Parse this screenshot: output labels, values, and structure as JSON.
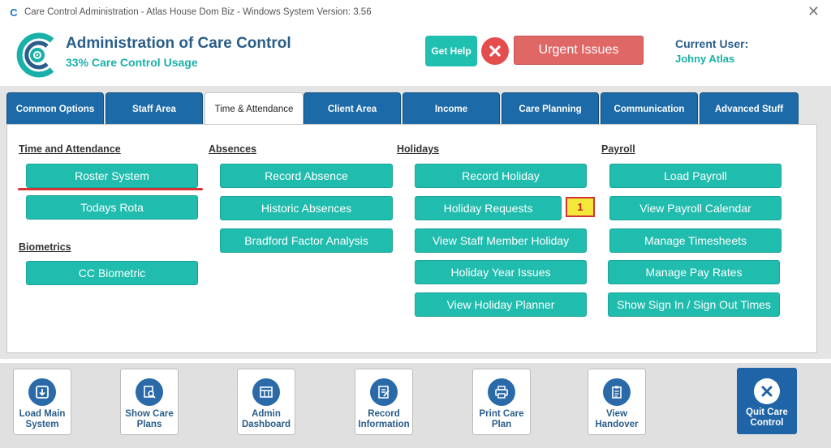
{
  "window": {
    "title": "Care Control Administration - Atlas House Dom Biz - Windows System Version: 3.56",
    "close_glyph": "✕"
  },
  "header": {
    "title": "Administration of Care Control",
    "subtitle": "33% Care Control Usage",
    "get_help": "Get Help",
    "urgent_issues": "Urgent Issues",
    "current_user_label": "Current User:",
    "current_user_name": "Johny Atlas"
  },
  "tabs": [
    {
      "label": "Common Options"
    },
    {
      "label": "Staff Area"
    },
    {
      "label": "Time & Attendance"
    },
    {
      "label": "Client Area"
    },
    {
      "label": "Income"
    },
    {
      "label": "Care Planning"
    },
    {
      "label": "Communication"
    },
    {
      "label": "Advanced Stuff"
    }
  ],
  "sections": {
    "time_attendance": {
      "title": "Time and Attendance",
      "buttons": [
        "Roster System",
        "Todays Rota"
      ]
    },
    "biometrics": {
      "title": "Biometrics",
      "buttons": [
        "CC Biometric"
      ]
    },
    "absences": {
      "title": "Absences",
      "buttons": [
        "Record Absence",
        "Historic Absences",
        "Bradford Factor Analysis"
      ]
    },
    "holidays": {
      "title": "Holidays",
      "buttons": [
        "Record Holiday",
        "Holiday Requests",
        "View Staff Member Holiday",
        "Holiday Year Issues",
        "View Holiday Planner"
      ],
      "requests_badge": "1"
    },
    "payroll": {
      "title": "Payroll",
      "buttons": [
        "Load Payroll",
        "View Payroll Calendar",
        "Manage Timesheets",
        "Manage Pay Rates",
        "Show Sign In / Sign Out Times"
      ]
    }
  },
  "quick_buttons": [
    {
      "label1": "Load Main",
      "label2": "System",
      "icon": "download-icon"
    },
    {
      "label1": "Show Care",
      "label2": "Plans",
      "icon": "document-search-icon"
    },
    {
      "label1": "Admin",
      "label2": "Dashboard",
      "icon": "dashboard-icon"
    },
    {
      "label1": "Record",
      "label2": "Information",
      "icon": "edit-document-icon"
    },
    {
      "label1": "Print Care",
      "label2": "Plan",
      "icon": "printer-icon"
    },
    {
      "label1": "View",
      "label2": "Handover",
      "icon": "clipboard-icon"
    }
  ],
  "quit": {
    "label1": "Quit Care",
    "label2": "Control"
  },
  "colors": {
    "teal": "#20bcae",
    "navy": "#1c6aa8",
    "urgent": "#df6766",
    "badge": "#f3e93a"
  }
}
